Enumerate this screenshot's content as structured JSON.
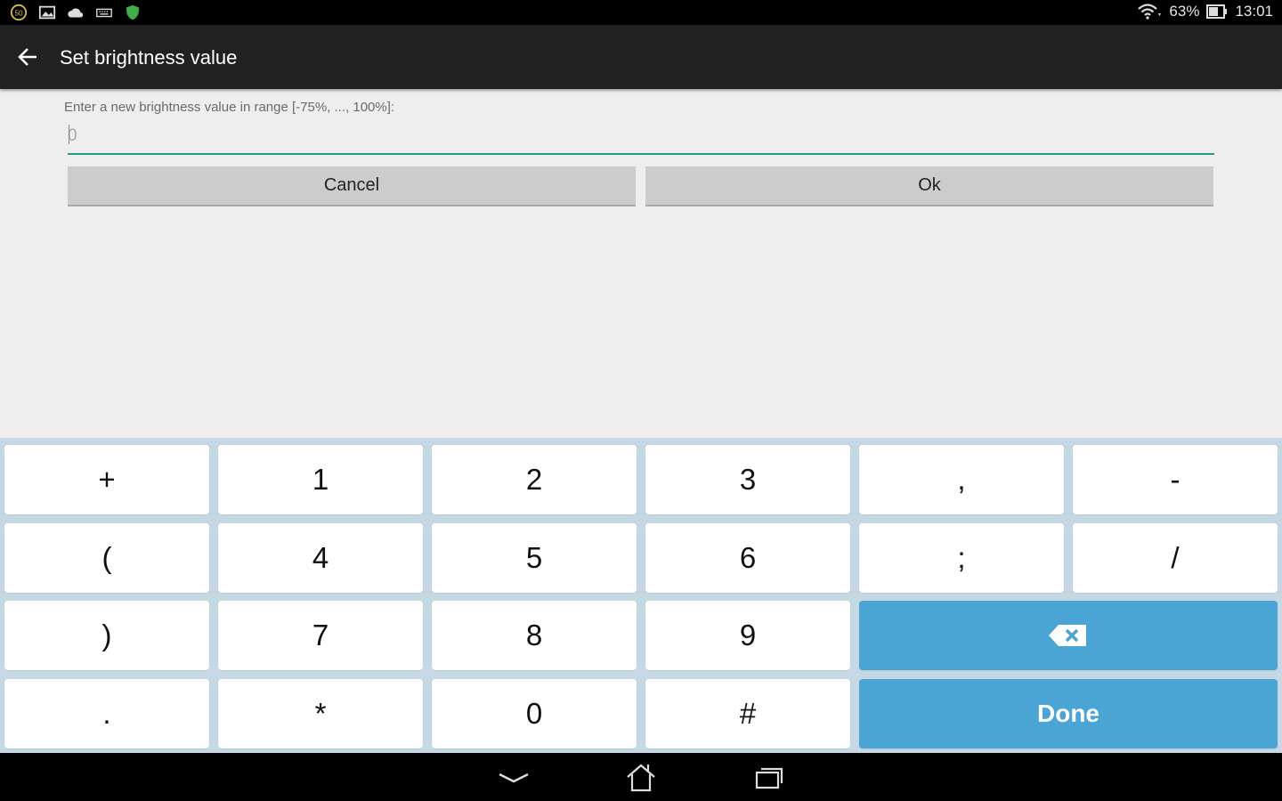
{
  "status_bar": {
    "left_icons": [
      "speed-50-icon",
      "image-icon",
      "cloud-icon",
      "keyboard-icon",
      "shield-icon"
    ],
    "battery_percent": "63%",
    "time": "13:01"
  },
  "action_bar": {
    "title": "Set brightness value"
  },
  "dialog": {
    "prompt": "Enter a new brightness value in range [-75%, ..., 100%]:",
    "input_placeholder": "0",
    "input_value": "",
    "cancel_label": "Cancel",
    "ok_label": "Ok"
  },
  "keyboard": {
    "rows": [
      [
        "+",
        "1",
        "2",
        "3",
        ",",
        "-"
      ],
      [
        "(",
        "4",
        "5",
        "6",
        ";",
        "/"
      ],
      [
        ")",
        "7",
        "8",
        "9"
      ],
      [
        ".",
        "*",
        "0",
        "#"
      ]
    ],
    "backspace_icon": "backspace-icon",
    "done_label": "Done",
    "accent_color": "#4aa4d4"
  },
  "nav_bar": {
    "icons": [
      "back-chevron-icon",
      "home-icon",
      "recents-icon"
    ]
  }
}
